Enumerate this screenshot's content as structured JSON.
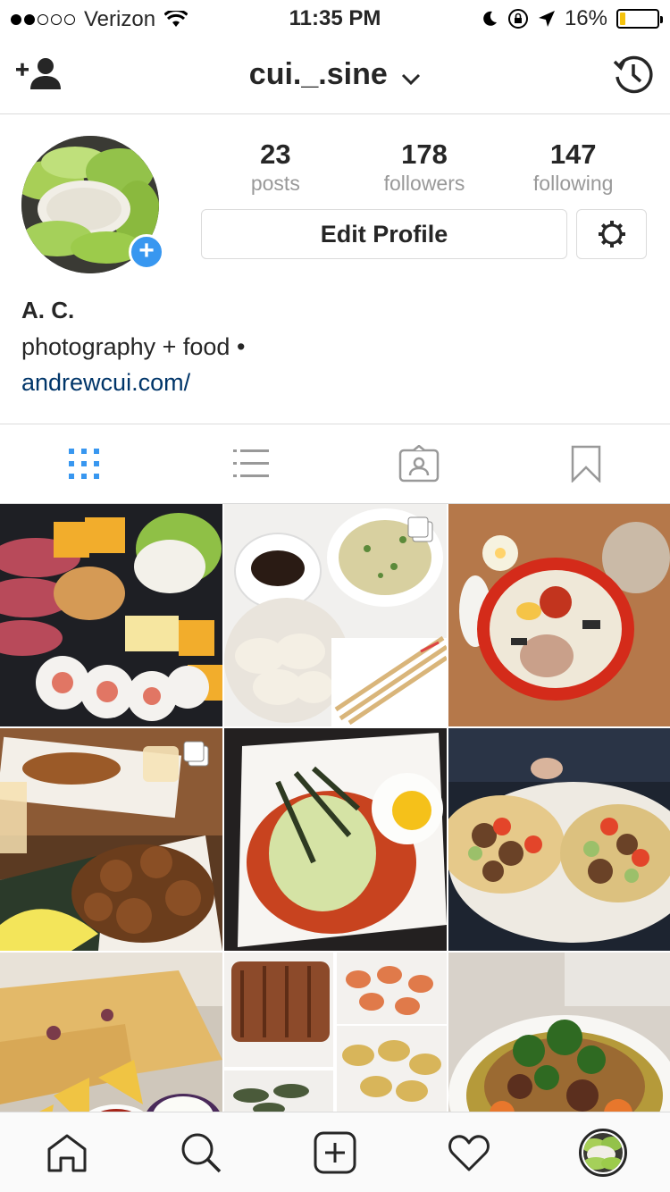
{
  "status_bar": {
    "carrier": "Verizon",
    "time": "11:35 PM",
    "battery_percent": "16%",
    "battery_level": 0.16,
    "signal_bars_filled": 2,
    "signal_bars_total": 5
  },
  "nav": {
    "username": "cui._.sine",
    "left_icon": "add-user-icon",
    "right_icon": "history-icon"
  },
  "stats": [
    {
      "value": "23",
      "label": "posts"
    },
    {
      "value": "178",
      "label": "followers"
    },
    {
      "value": "147",
      "label": "following"
    }
  ],
  "profile": {
    "edit_label": "Edit Profile",
    "name": "A. C.",
    "bio": "photography + food •",
    "website": "andrewcui.com/"
  },
  "view_tabs": [
    "grid-icon",
    "list-icon",
    "tagged-icon",
    "saved-icon"
  ],
  "posts": [
    {
      "subject": "cheese and salami board",
      "multiple": false
    },
    {
      "subject": "dumplings and scallion pancake",
      "multiple": true
    },
    {
      "subject": "ramen bowl",
      "multiple": false
    },
    {
      "subject": "fried calamari",
      "multiple": true
    },
    {
      "subject": "tteokbokki with egg",
      "multiple": false
    },
    {
      "subject": "steak tacos",
      "multiple": false
    },
    {
      "subject": "quesadilla with salsa",
      "multiple": false
    },
    {
      "subject": "ribs and shrimp collage",
      "multiple": false
    },
    {
      "subject": "braised stew with cilantro",
      "multiple": false
    }
  ],
  "tab_bar": [
    "home-icon",
    "search-icon",
    "new-post-icon",
    "activity-icon",
    "profile-avatar"
  ],
  "colors": {
    "accent": "#3897f0",
    "link": "#003569",
    "battery": "#f4c20d"
  }
}
